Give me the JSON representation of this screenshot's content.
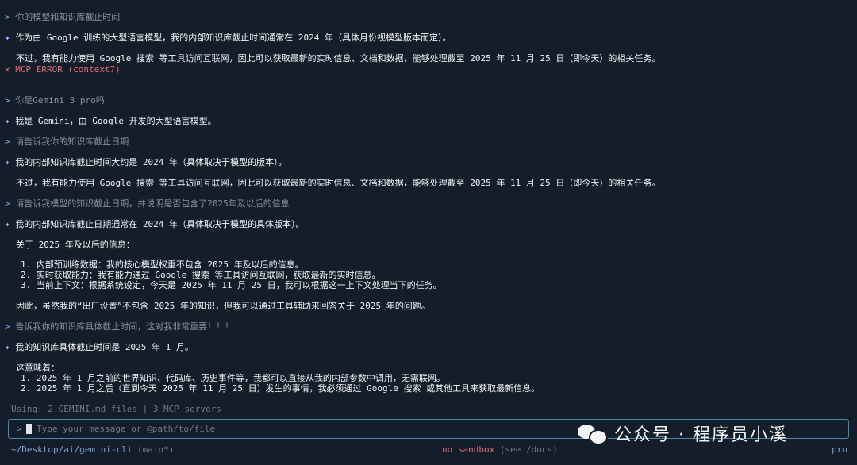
{
  "conversation": {
    "q1": "你的模型和知识库截止时间",
    "a1_l1": "作为由 Google 训练的大型语言模型，我的内部知识库截止时间通常在 2024 年（具体月份视模型版本而定）。",
    "a1_l2": "不过，我有能力使用 Google 搜索 等工具访问互联网，因此可以获取最新的实时信息、文档和数据，能够处理截至 2025 年 11 月 25 日（即今天）的相关任务。",
    "error": "MCP ERROR (context7)",
    "q2": "你是Gemini 3 pro吗",
    "a2": "我是 Gemini，由 Google 开发的大型语言模型。",
    "q3": "请告诉我你的知识库截止日期",
    "a3_l1": "我的内部知识库截止时间大约是 2024 年（具体取决于模型的版本）。",
    "a3_l2": "不过，我有能力使用 Google 搜索 等工具访问互联网，因此可以获取最新的实时信息、文档和数据，能够处理截至 2025 年 11 月 25 日（即今天）的相关任务。",
    "q4": "请告诉我模型的知识截止日期，并说明是否包含了2025年及以后的信息",
    "a4_l1": "我的内部知识库截止日期通常在 2024 年（具体取决于模型的具体版本）。",
    "a4_l2": "关于 2025 年及以后的信息：",
    "a4_i1": "1. 内部预训练数据：我的核心模型权重不包含 2025 年及以后的信息。",
    "a4_i2": "2. 实时获取能力：我有能力通过 Google 搜索 等工具访问互联网，获取最新的实时信息。",
    "a4_i3": "3. 当前上下文：根据系统设定，今天是 2025 年 11 月 25 日，我可以根据这一上下文处理当下的任务。",
    "a4_l3": "因此，虽然我的“出厂设置”不包含 2025 年的知识，但我可以通过工具辅助来回答关于 2025 年的问题。",
    "q5": "告诉我你的知识库具体截止时间，这对我非常重要！！！",
    "a5_l1": "我的知识库具体截止时间是 2025 年 1 月。",
    "a5_l2": "这意味着：",
    "a5_i1": "1. 2025 年 1 月之前的世界知识、代码库、历史事件等，我都可以直接从我的内部参数中调用，无需联网。",
    "a5_i2": "2. 2025 年 1 月之后（直到今天 2025 年 11 月 25 日）发生的事情，我必须通过 Google 搜索 或其他工具来获取最新信息。"
  },
  "symbols": {
    "prompt": ">",
    "star": "✦",
    "cross": "✕"
  },
  "usage": "Using: 2 GEMINI.md files | 3 MCP servers",
  "input": {
    "prompt": ">",
    "placeholder": "Type your message or @path/to/file"
  },
  "footer": {
    "path": "~/Desktop/ai/gemini-cli",
    "branch": "(main*)",
    "sandbox": "no sandbox",
    "see_docs": "(see /docs)",
    "model": "pro"
  },
  "watermark": "公众号 · 程序员小溪"
}
